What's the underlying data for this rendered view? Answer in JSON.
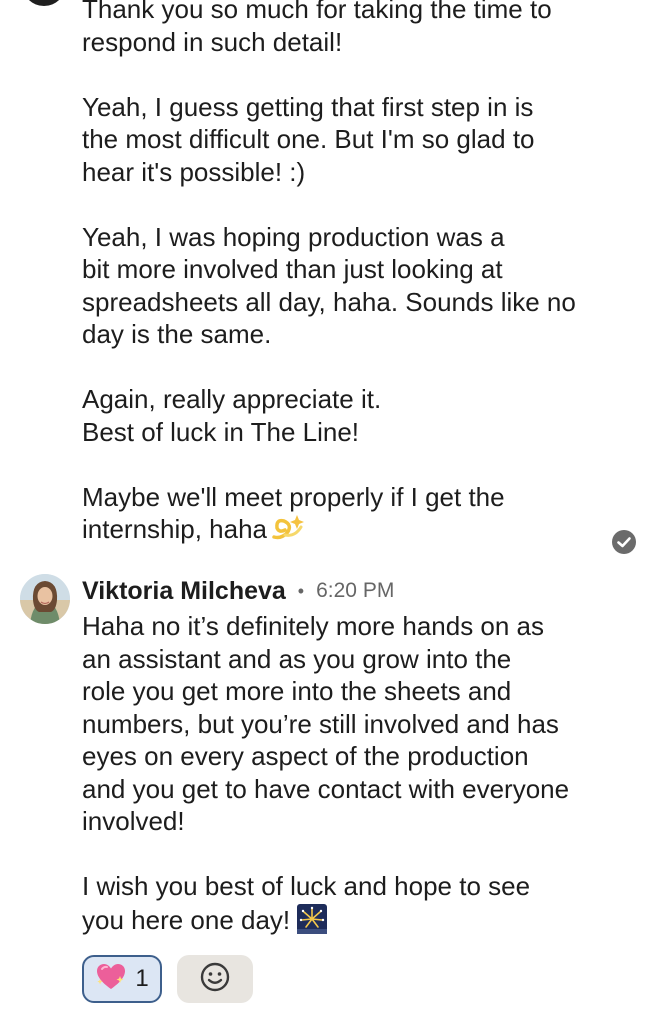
{
  "message_1": {
    "text": "Thank you so much for taking the time to\nrespond in such detail!\n\nYeah, I guess getting that first step in is\nthe most difficult one. But I'm so glad to\nhear it's possible! :)\n\nYeah, I was hoping production was a\nbit more involved than just looking at\nspreadsheets all day, haha. Sounds like no\nday is the same.\n\nAgain, really appreciate it.\nBest of luck in The Line!\n\nMaybe we'll meet properly if I get the\ninternship, haha",
    "emoji_icon": "dizzy-sparkle-icon",
    "status_icon": "read-check-icon"
  },
  "message_2": {
    "sender": "Viktoria Milcheva",
    "separator": "•",
    "time": "6:20 PM",
    "text": "Haha no it’s definitely more hands on as\nan assistant and as you grow into the\nrole you get more into the sheets and\nnumbers, but you’re still involved and has\neyes on every aspect of the production\nand you get to have contact with everyone\ninvolved!\n\nI wish you best of luck and hope to see\nyou here one day!",
    "emoji_icon": "fireworks-icon"
  },
  "reactions": {
    "items": [
      {
        "icon": "sparkling-heart-icon",
        "count": "1"
      }
    ],
    "add_icon": "smiley-face-icon"
  },
  "colors": {
    "reaction_border": "#3d5f8c",
    "reaction_bg": "#dce6f4",
    "add_reaction_bg": "#e8e5e0",
    "timestamp": "#666666"
  }
}
